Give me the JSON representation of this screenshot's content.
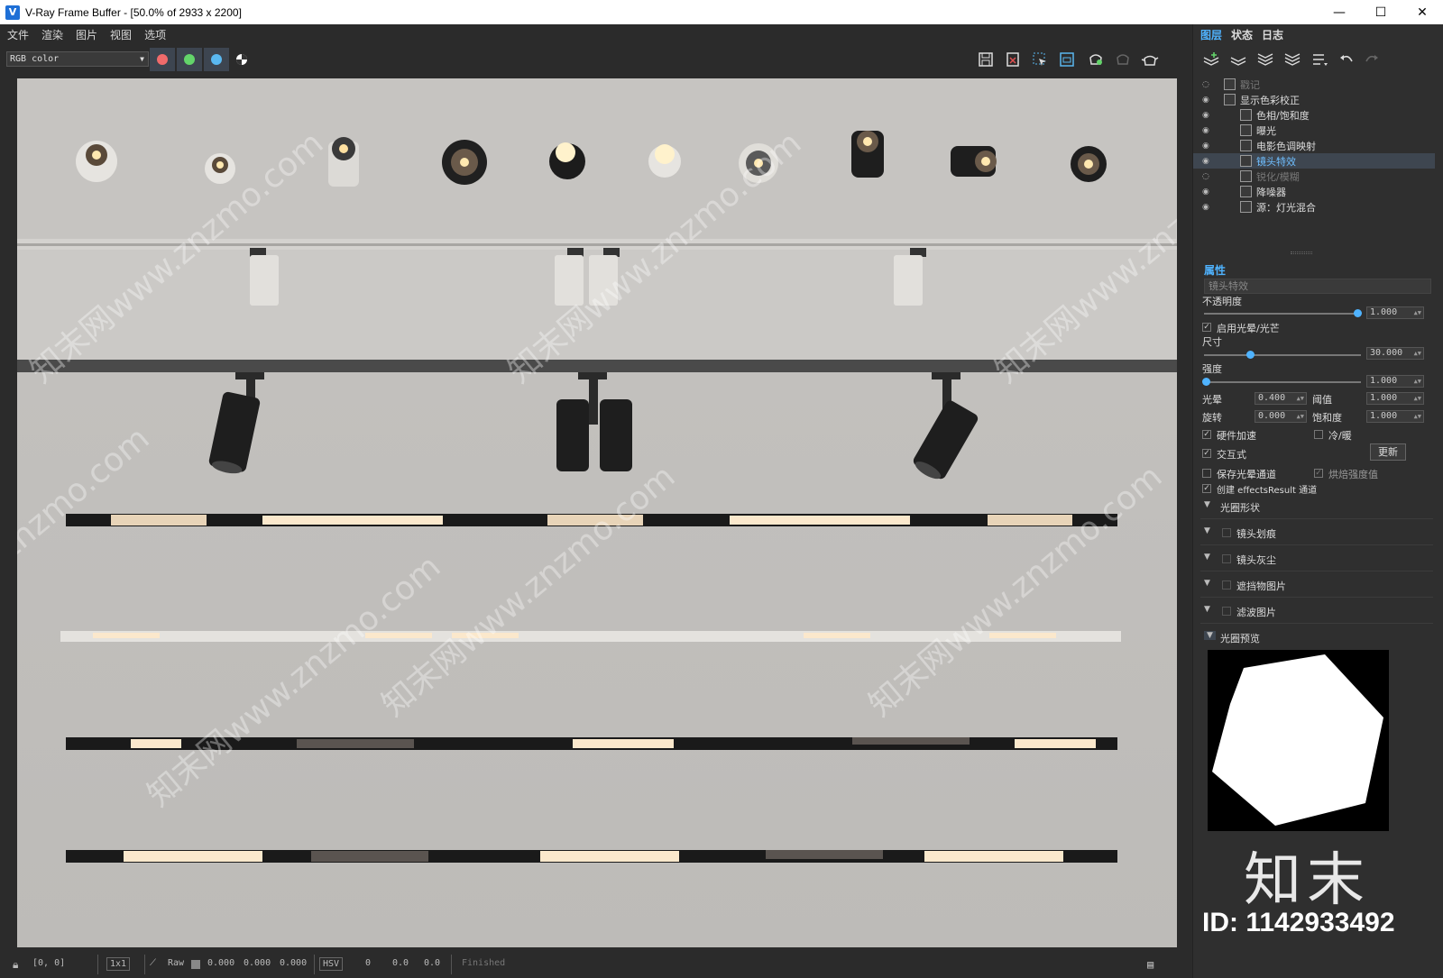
{
  "window": {
    "title": "V-Ray Frame Buffer - [50.0% of 2933 x 2200]",
    "minimize": "—",
    "maximize": "☐",
    "close": "✕"
  },
  "menu": [
    "文件",
    "渲染",
    "图片",
    "视图",
    "选项"
  ],
  "toolbar": {
    "channel": "RGB color",
    "channel_colors": {
      "red": "#f06b6b",
      "green": "#63d46a",
      "blue": "#5ab8f0"
    },
    "right_icons": [
      "save-icon",
      "clear-icon",
      "region-select-icon",
      "region-render-icon",
      "render-icon",
      "render-disabled-icon",
      "teapot-icon"
    ]
  },
  "render_watermarks": [
    "知末网www.znzmo.com",
    "知末网www.znzmo.com",
    "知末网www.znzmo.com",
    "znzmo.com",
    "知末网www.znzmo.com",
    "知末网www.znzmo.com",
    "知末网www.znzmo.com"
  ],
  "statusbar": {
    "coords": "[0, 0]",
    "zoom": "1x1",
    "mode": "Raw",
    "values": [
      "0.000",
      "0.000",
      "0.000"
    ],
    "colorspace": "HSV",
    "hsv_values": [
      "0",
      "0.0",
      "0.0"
    ],
    "status": "Finished"
  },
  "panel": {
    "tabs": [
      "图层",
      "状态",
      "日志"
    ],
    "layers": [
      {
        "name": "戳记",
        "visible": false,
        "indent": 0,
        "dim": true,
        "selected": false
      },
      {
        "name": "显示色彩校正",
        "visible": true,
        "indent": 0,
        "dim": false,
        "selected": false
      },
      {
        "name": "色相/饱和度",
        "visible": true,
        "indent": 1,
        "dim": false,
        "selected": false
      },
      {
        "name": "曝光",
        "visible": true,
        "indent": 1,
        "dim": false,
        "selected": false
      },
      {
        "name": "电影色调映射",
        "visible": true,
        "indent": 1,
        "dim": false,
        "selected": false
      },
      {
        "name": "镜头特效",
        "visible": true,
        "indent": 1,
        "dim": false,
        "selected": true
      },
      {
        "name": "锐化/模糊",
        "visible": false,
        "indent": 1,
        "dim": true,
        "selected": false
      },
      {
        "name": "降噪器",
        "visible": true,
        "indent": 1,
        "dim": false,
        "selected": false
      },
      {
        "name": "源：灯光混合",
        "visible": true,
        "indent": 1,
        "dim": false,
        "selected": false
      }
    ],
    "properties": {
      "title": "属性",
      "layer_name": "镜头特效",
      "opacity_label": "不透明度",
      "opacity": "1.000",
      "opacity_level": 1.0,
      "enable_bloom_label": "启用光晕/光芒",
      "size_label": "尺寸",
      "size": "30.000",
      "size_level": 0.3,
      "intensity_label": "强度",
      "intensity": "1.000",
      "intensity_level": 0.01,
      "bloom_label": "光晕",
      "bloom": "0.400",
      "threshold_label": "阈值",
      "threshold": "1.000",
      "rotation_label": "旋转",
      "rotation": "0.000",
      "saturation_label": "饱和度",
      "saturation": "1.000",
      "hw_accel_label": "硬件加速",
      "cold_warm_label": "冷/暖",
      "interactive_label": "交互式",
      "update_label": "更新",
      "save_bloom_label": "保存光晕通道",
      "bake_intensity_label": "烘焙强度值",
      "create_effects_label": "创建 effectsResult 通道",
      "sections": [
        "光圈形状",
        "镜头划痕",
        "镜头灰尘",
        "遮挡物图片",
        "滤波图片",
        "光圈预览"
      ]
    },
    "logo": "知末",
    "id": "ID: 1142933492"
  }
}
